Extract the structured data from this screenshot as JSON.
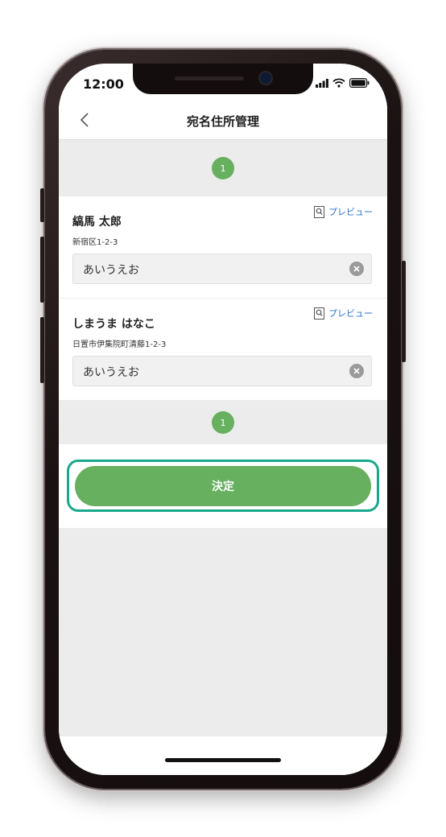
{
  "status_bar": {
    "time": "12:00"
  },
  "header": {
    "title": "宛名住所管理"
  },
  "pager": {
    "top_page": "1",
    "bottom_page": "1"
  },
  "recipients": [
    {
      "name": "縞馬 太郎",
      "address": "新宿区1-2-3",
      "preview_label": "プレビュー",
      "input_value": "あいうえお"
    },
    {
      "name": "しまうま はなこ",
      "address": "日置市伊集院町清藤1-2-3",
      "preview_label": "プレビュー",
      "input_value": "あいうえお"
    }
  ],
  "submit": {
    "label": "決定"
  },
  "icons": {
    "back": "chevron-left-icon",
    "preview": "magnifier-icon",
    "clear": "clear-circle-icon",
    "signal": "signal-icon",
    "wifi": "wifi-icon",
    "battery": "battery-icon"
  },
  "colors": {
    "accent_green": "#66b060",
    "highlight_teal": "#18a88c",
    "link_blue": "#2d70c8"
  }
}
